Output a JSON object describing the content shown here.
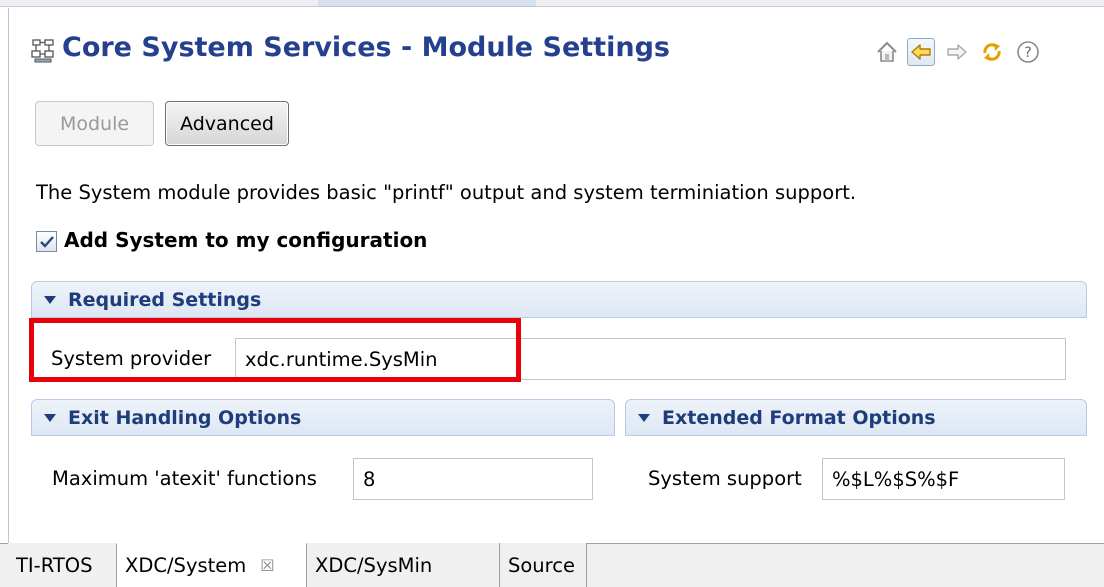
{
  "title": "Core System Services - Module Settings",
  "toolbar": {
    "home_icon": "home-icon",
    "back_icon": "back-arrow-icon",
    "forward_icon": "forward-arrow-icon",
    "sync_icon": "sync-icon",
    "help_icon": "help-icon"
  },
  "mode_buttons": {
    "module": "Module",
    "advanced": "Advanced"
  },
  "description": "The System module provides basic \"printf\" output and system terminiation support.",
  "add_checkbox": {
    "label": "Add System to my configuration",
    "checked": true
  },
  "required_settings": {
    "header": "Required Settings",
    "provider_label": "System provider",
    "provider_value": "xdc.runtime.SysMin"
  },
  "exit_handling": {
    "header": "Exit Handling Options",
    "atexit_label": "Maximum 'atexit' functions",
    "atexit_value": "8"
  },
  "extended_format": {
    "header": "Extended Format Options",
    "support_label": "System support",
    "support_value": "%$L%$S%$F"
  },
  "tabs": [
    {
      "label": "TI-RTOS",
      "active": false
    },
    {
      "label": "XDC/System",
      "active": true,
      "close": "☒"
    },
    {
      "label": "XDC/SysMin",
      "active": false
    },
    {
      "label": "Source",
      "active": false
    }
  ],
  "colors": {
    "title": "#24408f",
    "section_header": "#1e3d7a",
    "highlight": "#e8000b"
  }
}
